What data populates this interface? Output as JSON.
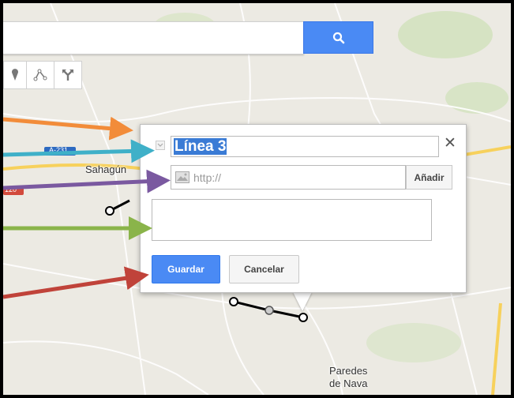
{
  "map": {
    "labels": {
      "sahagun": "Sahagún",
      "paredes_line1": "Paredes",
      "paredes_line2": "de Nava",
      "road_a231": "A-231",
      "road_120": "120"
    }
  },
  "search": {
    "button_icon": "search-icon"
  },
  "toolbar": {
    "tools": [
      "marker-icon",
      "line-icon",
      "directions-icon"
    ]
  },
  "popup": {
    "title_value": "Línea 3",
    "url_placeholder": "http://",
    "add_label": "Añadir",
    "save_label": "Guardar",
    "cancel_label": "Cancelar",
    "close_icon": "close-icon"
  },
  "annotations": {
    "arrow_colors": [
      "#f28c3a",
      "#3fb0c8",
      "#7a59a0",
      "#8ab44a",
      "#c0433a"
    ]
  },
  "colors": {
    "accent_blue": "#4a8af4",
    "selection_blue": "#3a7bd5"
  }
}
